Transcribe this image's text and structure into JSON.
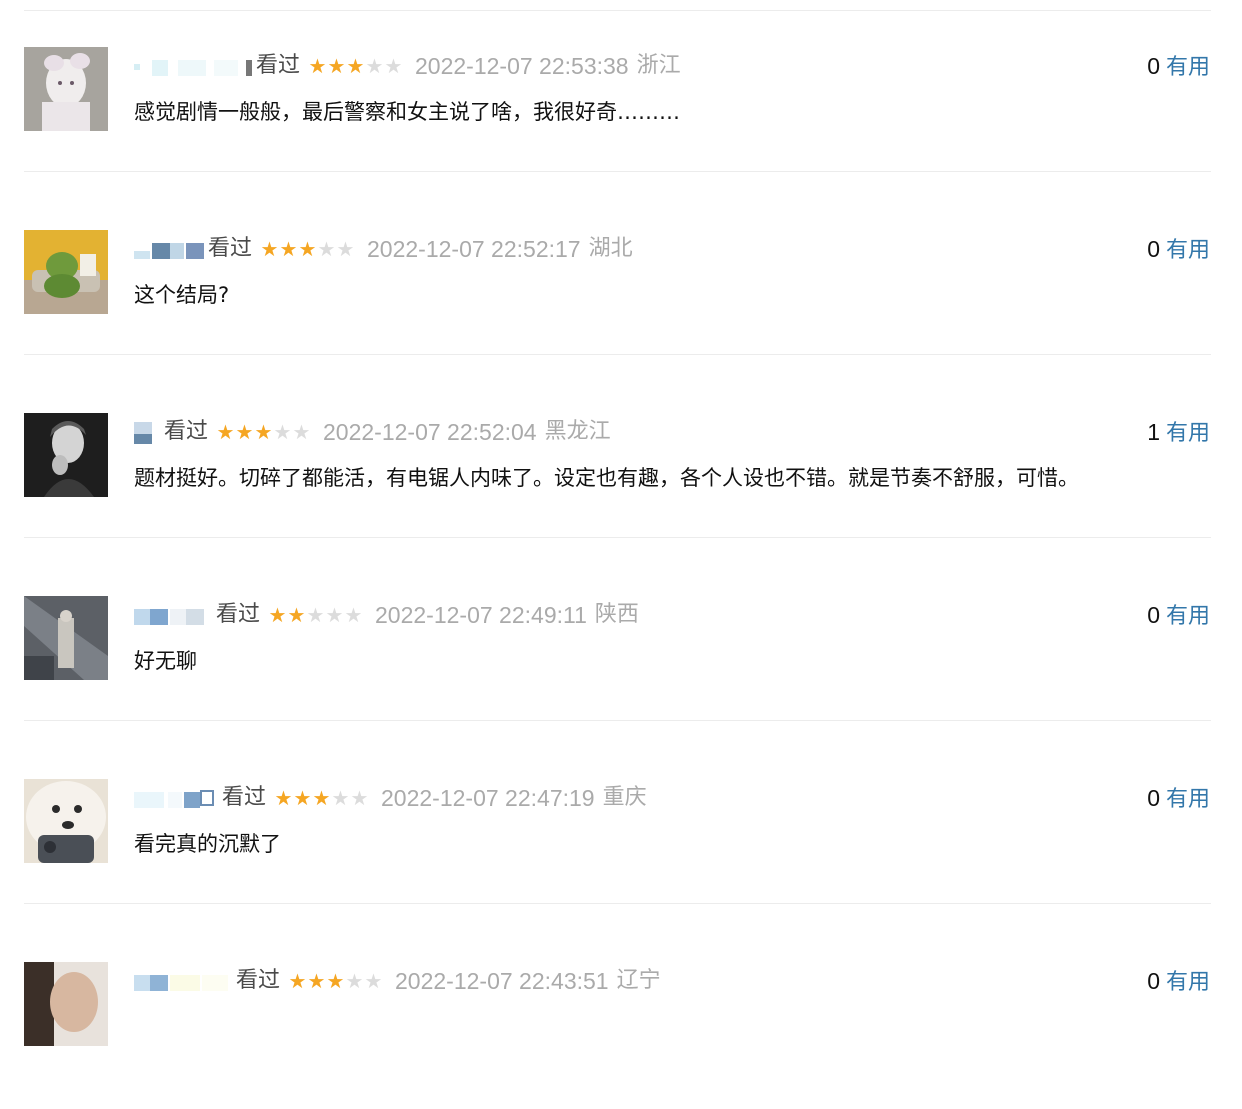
{
  "colors": {
    "star_on": "#f5a623",
    "star_off": "#dcdcdc",
    "link": "#3377aa",
    "meta_gray": "#aaaaaa",
    "text": "#111111"
  },
  "comments": [
    {
      "status": "看过",
      "rating": 3,
      "max_rating": 5,
      "time": "2022-12-07 22:53:38",
      "region": "浙江",
      "votes": "0",
      "useful_label": "有用",
      "content": "感觉剧情一般般，最后警察和女主说了啥，我很好奇………"
    },
    {
      "status": "看过",
      "rating": 3,
      "max_rating": 5,
      "time": "2022-12-07 22:52:17",
      "region": "湖北",
      "votes": "0",
      "useful_label": "有用",
      "content": "这个结局?"
    },
    {
      "status": "看过",
      "rating": 3,
      "max_rating": 5,
      "time": "2022-12-07 22:52:04",
      "region": "黑龙江",
      "votes": "1",
      "useful_label": "有用",
      "content": "题材挺好。切碎了都能活，有电锯人内味了。设定也有趣，各个人设也不错。就是节奏不舒服，可惜。"
    },
    {
      "status": "看过",
      "rating": 2,
      "max_rating": 5,
      "time": "2022-12-07 22:49:11",
      "region": "陕西",
      "votes": "0",
      "useful_label": "有用",
      "content": "好无聊"
    },
    {
      "status": "看过",
      "rating": 3,
      "max_rating": 5,
      "time": "2022-12-07 22:47:19",
      "region": "重庆",
      "votes": "0",
      "useful_label": "有用",
      "content": "看完真的沉默了"
    },
    {
      "status": "看过",
      "rating": 3,
      "max_rating": 5,
      "time": "2022-12-07 22:43:51",
      "region": "辽宁",
      "votes": "0",
      "useful_label": "有用",
      "content": ""
    }
  ]
}
